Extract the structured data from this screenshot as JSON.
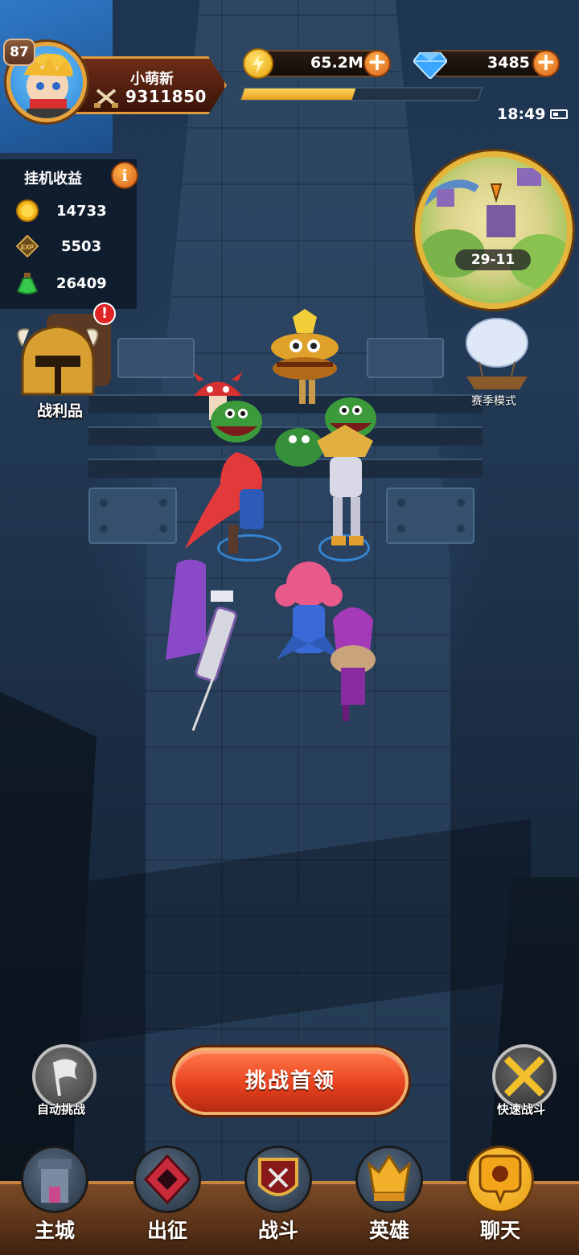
{
  "player": {
    "level": "87",
    "name": "小萌新",
    "power": "9311850"
  },
  "resources": {
    "gold": "65.2M",
    "gems": "3485",
    "xp_progress": 0.47
  },
  "status_bar": {
    "time": "18:49"
  },
  "idle_rewards": {
    "title": "挂机收益",
    "info_label": "i",
    "rows": [
      {
        "icon": "gold-coin-icon",
        "value": "14733"
      },
      {
        "icon": "exp-icon",
        "value": "5503"
      },
      {
        "icon": "potion-icon",
        "value": "26409"
      }
    ]
  },
  "loot": {
    "label": "战利品",
    "alert": "!"
  },
  "minimap": {
    "stage": "29-11"
  },
  "season_mode": {
    "label": "赛季模式"
  },
  "controls": {
    "auto_challenge": "自动挑战",
    "challenge_boss": "挑战首领",
    "quick_battle": "快速战斗"
  },
  "nav": {
    "items": [
      {
        "label": "主城",
        "icon": "castle-icon"
      },
      {
        "label": "出征",
        "icon": "expedition-icon"
      },
      {
        "label": "战斗",
        "icon": "battle-icon"
      },
      {
        "label": "英雄",
        "icon": "hero-icon"
      },
      {
        "label": "聊天",
        "icon": "chat-icon"
      }
    ]
  },
  "colors": {
    "accent_gold": "#e5b53c",
    "challenge_red": "#e8421e",
    "xp_fill": "#f0b030"
  }
}
